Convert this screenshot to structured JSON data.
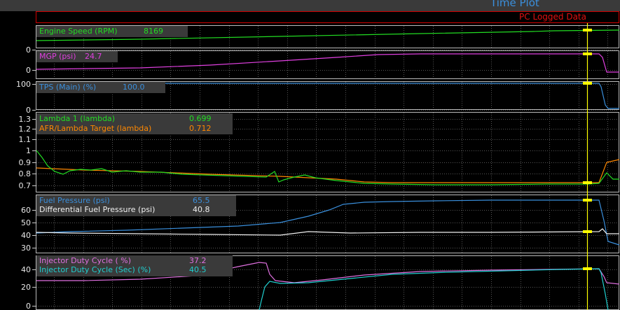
{
  "window": {
    "title": "Time Plot"
  },
  "logged_banner": "PC Logged Data",
  "panels": [
    {
      "id": "rpm",
      "ticks": [
        "0"
      ],
      "channels": [
        {
          "name": "Engine Speed (RPM)",
          "value": "8169",
          "color": "#22dd22"
        }
      ]
    },
    {
      "id": "mgp",
      "ticks": [
        "0"
      ],
      "channels": [
        {
          "name": "MGP (psi)",
          "value": "24.7",
          "color": "#e040e0"
        }
      ]
    },
    {
      "id": "tps",
      "ticks": [
        "100",
        "0"
      ],
      "channels": [
        {
          "name": "TPS (Main) (%)",
          "value": "100.0",
          "color": "#3a8fdc"
        }
      ]
    },
    {
      "id": "lambda",
      "ticks": [
        "1.3",
        "1.2",
        "1.1",
        "1",
        "0.9",
        "0.8",
        "0.7"
      ],
      "channels": [
        {
          "name": "Lambda 1 (lambda)",
          "value": "0.699",
          "color": "#22dd22"
        },
        {
          "name": "AFR/Lambda Target (lambda)",
          "value": "0.712",
          "color": "#ff8800"
        }
      ]
    },
    {
      "id": "fuel",
      "ticks": [
        "60",
        "50",
        "40",
        "30"
      ],
      "channels": [
        {
          "name": "Fuel Pressure (psi)",
          "value": "65.5",
          "color": "#3a8fdc"
        },
        {
          "name": "Differential Fuel Pressure (psi)",
          "value": "40.8",
          "color": "#f0f0f0"
        }
      ]
    },
    {
      "id": "inj",
      "ticks": [
        "40",
        "20",
        "0"
      ],
      "channels": [
        {
          "name": "Injector Duty Cycle ( %)",
          "value": "37.2",
          "color": "#e070e0"
        },
        {
          "name": "Injector Duty Cycle (Sec) (%)",
          "value": "40.5",
          "color": "#20d0d0"
        }
      ]
    }
  ],
  "cursor_color": "#ffff00",
  "grid_color": "#555555",
  "border_color": "#bbbbbb"
}
